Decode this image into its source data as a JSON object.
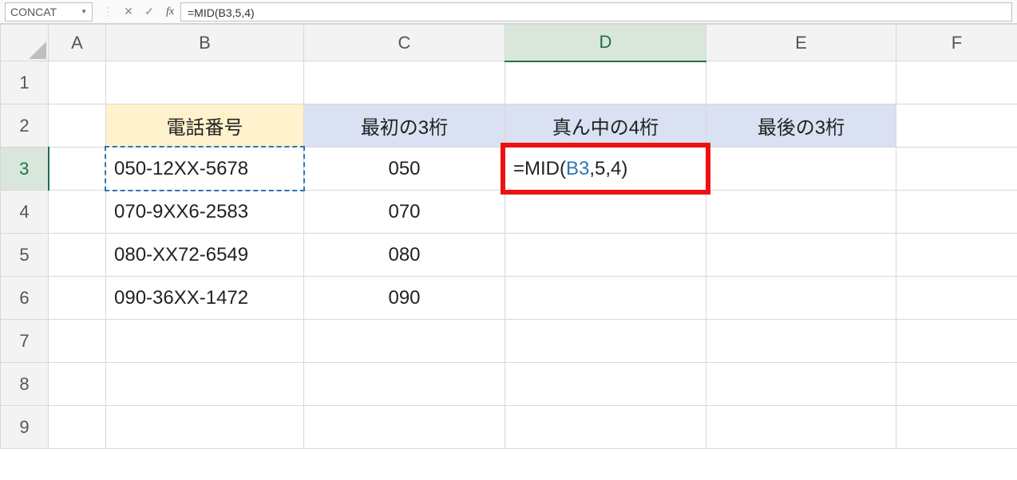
{
  "formula_bar": {
    "name_box": "CONCAT",
    "cancel_glyph": "✕",
    "accept_glyph": "✓",
    "fx_glyph": "fx",
    "formula_text": "=MID(B3,5,4)"
  },
  "columns": [
    "A",
    "B",
    "C",
    "D",
    "E",
    "F"
  ],
  "rows": [
    "1",
    "2",
    "3",
    "4",
    "5",
    "6",
    "7",
    "8",
    "9"
  ],
  "active": {
    "col": "D",
    "row": "3"
  },
  "headers": {
    "B": "電話番号",
    "C": "最初の3桁",
    "D": "真ん中の4桁",
    "E": "最後の3桁"
  },
  "data_rows": [
    {
      "row": "3",
      "phone": "050-12XX-5678",
      "first3": "050",
      "mid4_formula_plain": "=MID(",
      "mid4_formula_ref": "B3",
      "mid4_formula_tail": ",5,4)",
      "last3": ""
    },
    {
      "row": "4",
      "phone": "070-9XX6-2583",
      "first3": "070",
      "mid4": "",
      "last3": ""
    },
    {
      "row": "5",
      "phone": "080-XX72-6549",
      "first3": "080",
      "mid4": "",
      "last3": ""
    },
    {
      "row": "6",
      "phone": "090-36XX-1472",
      "first3": "090",
      "mid4": "",
      "last3": ""
    }
  ]
}
